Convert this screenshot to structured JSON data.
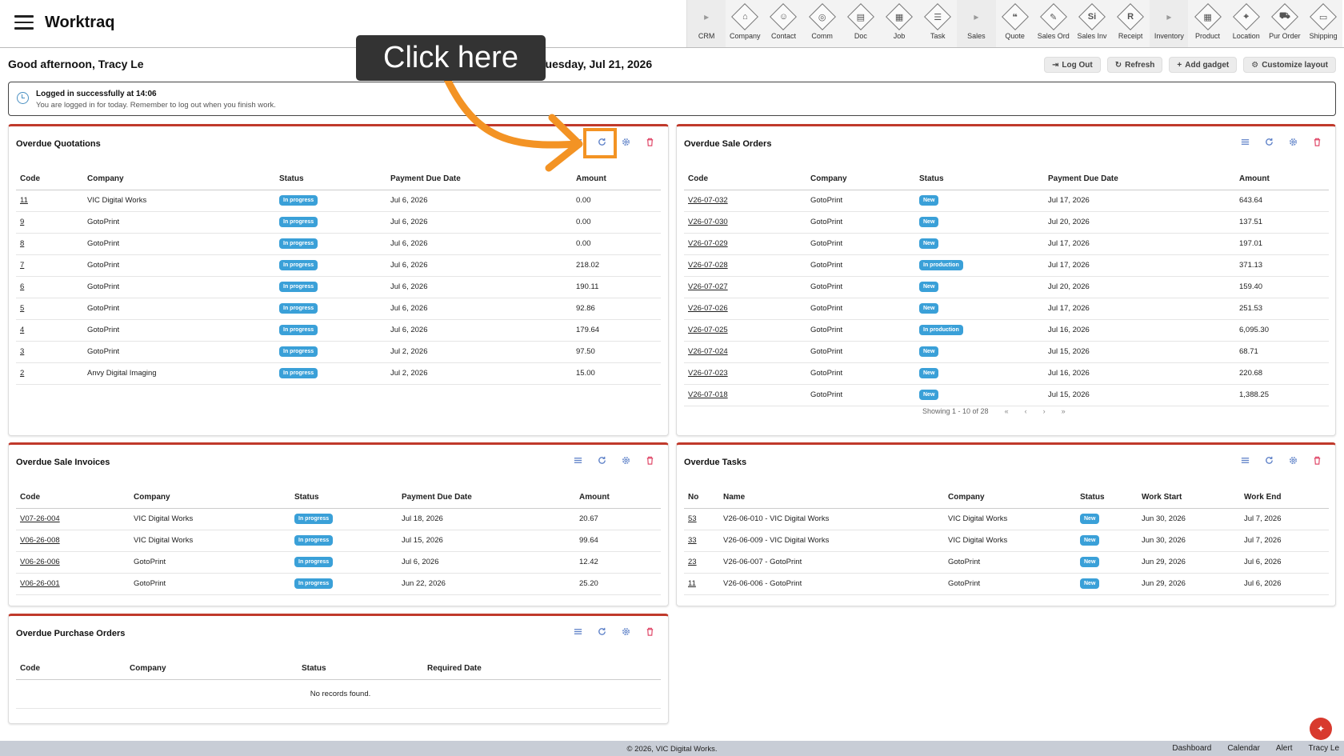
{
  "header": {
    "brand": "Worktraq",
    "modules": [
      {
        "label": "CRM",
        "glyph": "▸",
        "type": "section"
      },
      {
        "label": "Company",
        "glyph": "⌂",
        "type": "item"
      },
      {
        "label": "Contact",
        "glyph": "☺",
        "type": "item"
      },
      {
        "label": "Comm",
        "glyph": "◎",
        "type": "item"
      },
      {
        "label": "Doc",
        "glyph": "▤",
        "type": "item"
      },
      {
        "label": "Job",
        "glyph": "▦",
        "type": "item"
      },
      {
        "label": "Task",
        "glyph": "☰",
        "type": "item"
      },
      {
        "label": "Sales",
        "glyph": "▸",
        "type": "section"
      },
      {
        "label": "Quote",
        "glyph": "❝",
        "type": "item"
      },
      {
        "label": "Sales Ord",
        "glyph": "✎",
        "type": "item"
      },
      {
        "label": "Sales Inv",
        "glyph": "Si",
        "type": "item"
      },
      {
        "label": "Receipt",
        "glyph": "R",
        "type": "item"
      },
      {
        "label": "Inventory",
        "glyph": "▸",
        "type": "section"
      },
      {
        "label": "Product",
        "glyph": "▦",
        "type": "item"
      },
      {
        "label": "Location",
        "glyph": "⌖",
        "type": "item"
      },
      {
        "label": "Pur Order",
        "glyph": "⛟",
        "type": "item"
      },
      {
        "label": "Shipping",
        "glyph": "▭",
        "type": "item"
      }
    ]
  },
  "greeting": "Good afternoon, Tracy Le",
  "date": "Tuesday, Jul 21, 2026",
  "actions": {
    "logout": "Log Out",
    "refresh": "Refresh",
    "add_gadget": "Add gadget",
    "customize": "Customize layout"
  },
  "notice": {
    "title": "Logged in successfully at 14:06",
    "body": "You are logged in for today. Remember to log out when you finish work."
  },
  "tutorial": {
    "tooltip": "Click here"
  },
  "quotations": {
    "title": "Overdue Quotations",
    "columns": [
      "Code",
      "Company",
      "Status",
      "Payment Due Date",
      "Amount"
    ],
    "rows": [
      [
        "11",
        "VIC Digital Works",
        "In progress",
        "Jul 6, 2026",
        "0.00"
      ],
      [
        "9",
        "GotoPrint",
        "In progress",
        "Jul 6, 2026",
        "0.00"
      ],
      [
        "8",
        "GotoPrint",
        "In progress",
        "Jul 6, 2026",
        "0.00"
      ],
      [
        "7",
        "GotoPrint",
        "In progress",
        "Jul 6, 2026",
        "218.02"
      ],
      [
        "6",
        "GotoPrint",
        "In progress",
        "Jul 6, 2026",
        "190.11"
      ],
      [
        "5",
        "GotoPrint",
        "In progress",
        "Jul 6, 2026",
        "92.86"
      ],
      [
        "4",
        "GotoPrint",
        "In progress",
        "Jul 6, 2026",
        "179.64"
      ],
      [
        "3",
        "GotoPrint",
        "In progress",
        "Jul 2, 2026",
        "97.50"
      ],
      [
        "2",
        "Anvy Digital Imaging",
        "In progress",
        "Jul 2, 2026",
        "15.00"
      ]
    ]
  },
  "sale_orders": {
    "title": "Overdue Sale Orders",
    "columns": [
      "Code",
      "Company",
      "Status",
      "Payment Due Date",
      "Amount"
    ],
    "rows": [
      [
        "V26-07-032",
        "GotoPrint",
        "New",
        "Jul 17, 2026",
        "643.64"
      ],
      [
        "V26-07-030",
        "GotoPrint",
        "New",
        "Jul 20, 2026",
        "137.51"
      ],
      [
        "V26-07-029",
        "GotoPrint",
        "New",
        "Jul 17, 2026",
        "197.01"
      ],
      [
        "V26-07-028",
        "GotoPrint",
        "In production",
        "Jul 17, 2026",
        "371.13"
      ],
      [
        "V26-07-027",
        "GotoPrint",
        "New",
        "Jul 20, 2026",
        "159.40"
      ],
      [
        "V26-07-026",
        "GotoPrint",
        "New",
        "Jul 17, 2026",
        "251.53"
      ],
      [
        "V26-07-025",
        "GotoPrint",
        "In production",
        "Jul 16, 2026",
        "6,095.30"
      ],
      [
        "V26-07-024",
        "GotoPrint",
        "New",
        "Jul 15, 2026",
        "68.71"
      ],
      [
        "V26-07-023",
        "GotoPrint",
        "New",
        "Jul 16, 2026",
        "220.68"
      ],
      [
        "V26-07-018",
        "GotoPrint",
        "New",
        "Jul 15, 2026",
        "1,388.25"
      ]
    ],
    "pager": {
      "showing": "Showing 1 - 10 of 28",
      "first": "«",
      "prev": "‹",
      "next": "›",
      "last": "»"
    }
  },
  "sale_invoices": {
    "title": "Overdue Sale Invoices",
    "columns": [
      "Code",
      "Company",
      "Status",
      "Payment Due Date",
      "Amount"
    ],
    "rows": [
      [
        "V07-26-004",
        "VIC Digital Works",
        "In progress",
        "Jul 18, 2026",
        "20.67"
      ],
      [
        "V06-26-008",
        "VIC Digital Works",
        "In progress",
        "Jul 15, 2026",
        "99.64"
      ],
      [
        "V06-26-006",
        "GotoPrint",
        "In progress",
        "Jul 6, 2026",
        "12.42"
      ],
      [
        "V06-26-001",
        "GotoPrint",
        "In progress",
        "Jun 22, 2026",
        "25.20"
      ]
    ]
  },
  "tasks": {
    "title": "Overdue Tasks",
    "columns": [
      "No",
      "Name",
      "Company",
      "Status",
      "Work Start",
      "Work End"
    ],
    "rows": [
      [
        "53",
        "V26-06-010 - VIC Digital Works",
        "VIC Digital Works",
        "New",
        "Jun 30, 2026",
        "Jul 7, 2026"
      ],
      [
        "33",
        "V26-06-009 - VIC Digital Works",
        "VIC Digital Works",
        "New",
        "Jun 30, 2026",
        "Jul 7, 2026"
      ],
      [
        "23",
        "V26-06-007 - GotoPrint",
        "GotoPrint",
        "New",
        "Jun 29, 2026",
        "Jul 6, 2026"
      ],
      [
        "11",
        "V26-06-006 - GotoPrint",
        "GotoPrint",
        "New",
        "Jun 29, 2026",
        "Jul 6, 2026"
      ]
    ]
  },
  "purchase_orders": {
    "title": "Overdue Purchase Orders",
    "columns": [
      "Code",
      "Company",
      "Status",
      "Required Date"
    ],
    "empty": "No records found."
  },
  "footer": {
    "copyright": "© 2026, VIC Digital Works.",
    "links": [
      "Dashboard",
      "Calendar",
      "Alert",
      "Tracy Le"
    ]
  },
  "colors": {
    "accent": "#c0392b",
    "badge": "#3aa0d8",
    "highlight": "#f39324",
    "footer": "#c8cdd6"
  }
}
